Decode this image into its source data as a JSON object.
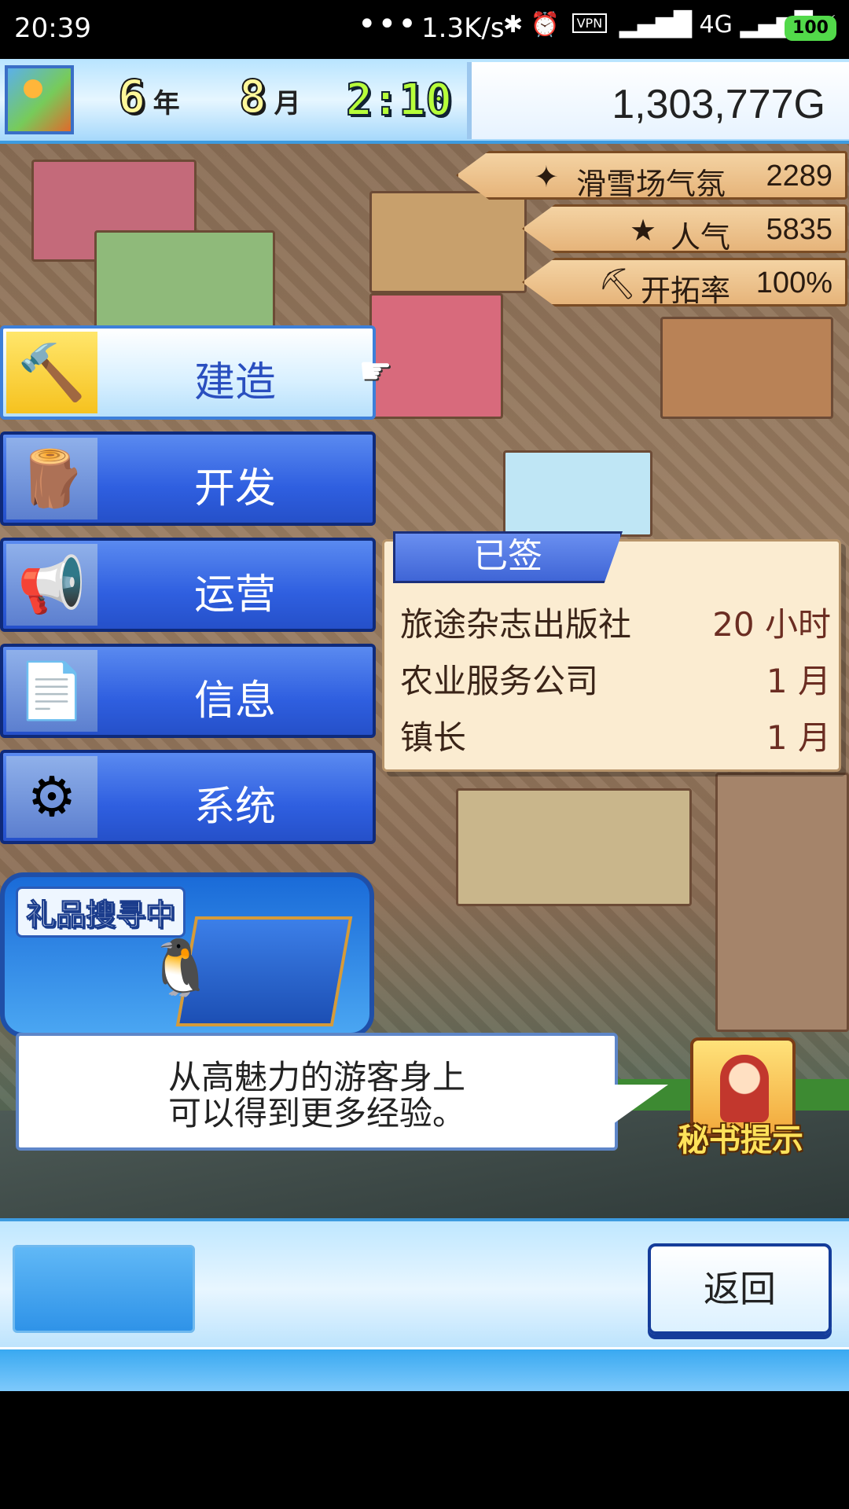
{
  "status_bar": {
    "time": "20:39",
    "dots": "•••",
    "net_speed": "1.3K/s",
    "vpn": "VPN",
    "signal": "4G",
    "battery": "100"
  },
  "header": {
    "year_num": "6",
    "year_unit": "年",
    "month_num": "8",
    "month_unit": "月",
    "clock": "2:10",
    "money": "1,303,777G"
  },
  "stats": [
    {
      "icon": "sparkle-icon",
      "glyph": "✦",
      "label": "滑雪场气氛",
      "value": "2289"
    },
    {
      "icon": "star-icon",
      "glyph": "★",
      "label": "人气",
      "value": "5835"
    },
    {
      "icon": "pickaxe-icon",
      "glyph": "⛏",
      "label": "开拓率",
      "value": "100%"
    }
  ],
  "menu": [
    {
      "label": "建造",
      "glyph": "🔨",
      "active": true
    },
    {
      "label": "开发",
      "glyph": "🪵",
      "active": false
    },
    {
      "label": "运营",
      "glyph": "📢",
      "active": false
    },
    {
      "label": "信息",
      "glyph": "📄",
      "active": false
    },
    {
      "label": "系统",
      "glyph": "⚙",
      "active": false
    }
  ],
  "signed_panel": {
    "tab": "已签",
    "rows": [
      {
        "name": "旅途杂志出版社",
        "duration": "20 小时"
      },
      {
        "name": "农业服务公司",
        "duration": "1 月"
      },
      {
        "name": "镇长",
        "duration": "1 月"
      }
    ]
  },
  "gift": {
    "title": "礼品搜寻中"
  },
  "tip": {
    "line1": "从高魅力的游客身上",
    "line2": "可以得到更多经验。"
  },
  "secretary": {
    "label": "秘书提示"
  },
  "bottom": {
    "back_label": "返回"
  }
}
